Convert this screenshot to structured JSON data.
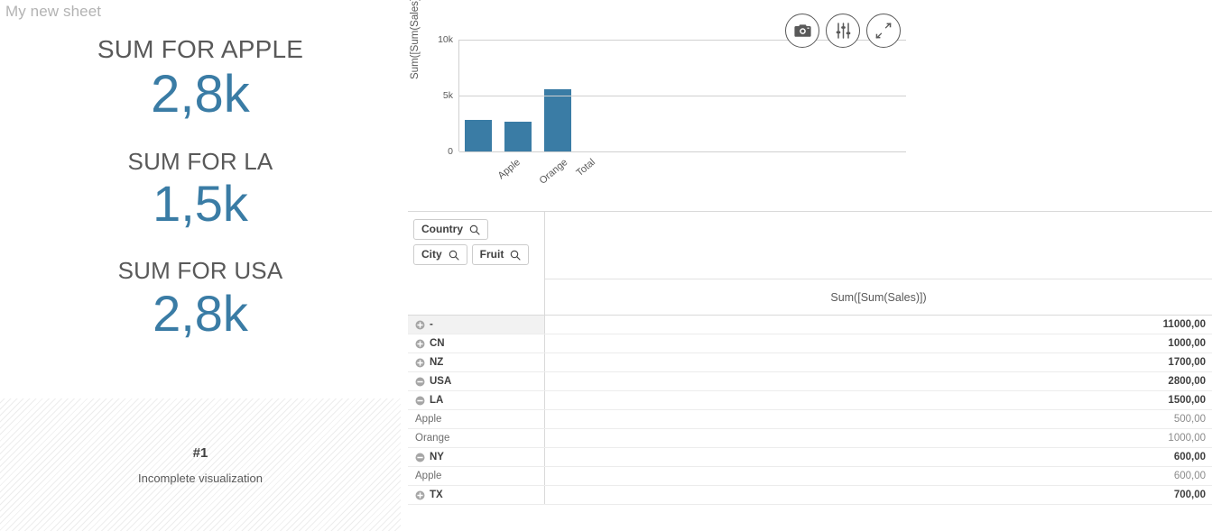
{
  "sheet": {
    "title": "My new sheet"
  },
  "colors": {
    "accent_blue": "#3a7ca5",
    "kpi_title": "#595959",
    "text_dark": "#404040",
    "text_light": "#8c8c8c",
    "border": "#d9d9d9",
    "title_gray": "#b3b3b3"
  },
  "kpis": [
    {
      "title": "SUM FOR APPLE",
      "value": "2,8k"
    },
    {
      "title": "SUM FOR LA",
      "value": "1,5k"
    },
    {
      "title": "SUM FOR USA",
      "value": "2,8k"
    }
  ],
  "placeholder": {
    "number": "#1",
    "message": "Incomplete visualization"
  },
  "chart_toolbar": [
    {
      "icon": "camera-icon",
      "label": "Snapshot"
    },
    {
      "icon": "sliders-icon",
      "label": "Properties"
    },
    {
      "icon": "expand-icon",
      "label": "Fullscreen"
    }
  ],
  "chart_data": {
    "type": "bar",
    "title": "",
    "categories": [
      "Apple",
      "Orange",
      "Total"
    ],
    "values": [
      2800,
      2700,
      5600
    ],
    "series": [
      {
        "name": "Sum([Sum(Sales)])",
        "values": [
          2800,
          2700,
          5600
        ]
      }
    ],
    "xlabel": "",
    "ylabel": "Sum([Sum(Sales)])",
    "ylim": [
      0,
      10000
    ],
    "yticks": [
      0,
      5000,
      10000
    ],
    "ytick_labels": [
      "0",
      "5k",
      "10k"
    ],
    "grid": true,
    "legend": "none",
    "bar_color": "#3a7ca5"
  },
  "pivot_table": {
    "dimension_buttons": [
      {
        "label": "Country",
        "icon": "search-icon"
      },
      {
        "label": "City",
        "icon": "search-icon"
      },
      {
        "label": "Fruit",
        "icon": "search-icon"
      }
    ],
    "measure_header": "Sum([Sum(Sales)])",
    "rows": [
      {
        "label": "-",
        "value": "11000,00",
        "level": 0,
        "state": "collapsed",
        "highlight": true
      },
      {
        "label": "CN",
        "value": "1000,00",
        "level": 0,
        "state": "collapsed",
        "highlight": false
      },
      {
        "label": "NZ",
        "value": "1700,00",
        "level": 0,
        "state": "collapsed",
        "highlight": false
      },
      {
        "label": "USA",
        "value": "2800,00",
        "level": 0,
        "state": "expanded",
        "highlight": false
      },
      {
        "label": "LA",
        "value": "1500,00",
        "level": 1,
        "state": "expanded",
        "highlight": false
      },
      {
        "label": "Apple",
        "value": "500,00",
        "level": 2,
        "state": "leaf",
        "highlight": false
      },
      {
        "label": "Orange",
        "value": "1000,00",
        "level": 2,
        "state": "leaf",
        "highlight": false
      },
      {
        "label": "NY",
        "value": "600,00",
        "level": 1,
        "state": "expanded",
        "highlight": false
      },
      {
        "label": "Apple",
        "value": "600,00",
        "level": 2,
        "state": "leaf",
        "highlight": false
      },
      {
        "label": "TX",
        "value": "700,00",
        "level": 1,
        "state": "collapsed",
        "highlight": false
      }
    ]
  }
}
